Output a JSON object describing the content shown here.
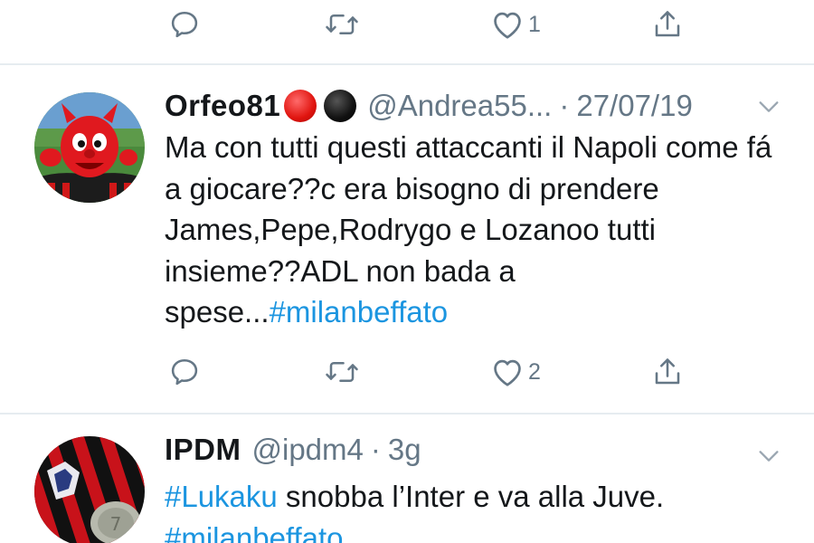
{
  "top_actions": {
    "like_count": "1"
  },
  "tweet1": {
    "display_name": "Orfeo81",
    "handle": "@Andrea55...",
    "separator": "·",
    "date": "27/07/19",
    "text_main": "Ma con tutti questi attaccanti il Napoli come fá a giocare??c era bisogno di prendere James,Pepe,Rodrygo e Lozanoo tutti insieme??ADL non bada a spese...",
    "hashtag": "#milanbeffato",
    "like_count": "2"
  },
  "tweet2": {
    "display_name": "IPDM",
    "handle": "@ipdm4",
    "separator": "·",
    "date": "3g",
    "hashtag1": "#Lukaku",
    "text_main": " snobba l’Inter e va alla Juve.",
    "hashtag2": "#milanbeffato"
  },
  "colors": {
    "icon_gray": "#657786",
    "link_blue": "#1b95e0",
    "divider": "#e6ecf0",
    "text": "#14171a"
  }
}
